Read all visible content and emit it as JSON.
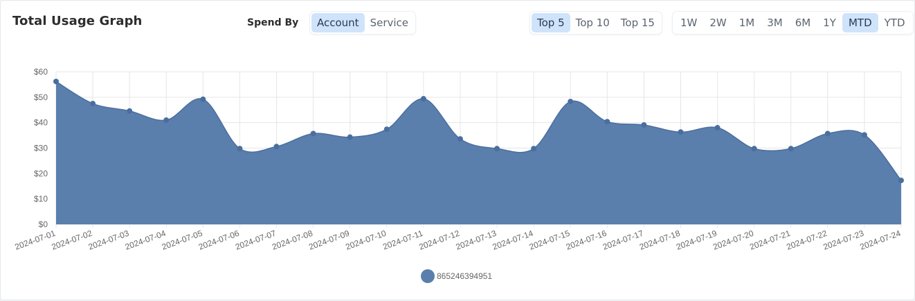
{
  "header": {
    "title": "Total Usage Graph",
    "spend_by_label": "Spend By"
  },
  "spend_by": {
    "options": [
      "Account",
      "Service"
    ],
    "selected": "Account"
  },
  "top_n": {
    "options": [
      "Top 5",
      "Top 10",
      "Top 15"
    ],
    "selected": "Top 5"
  },
  "time_range": {
    "options": [
      "1W",
      "2W",
      "1M",
      "3M",
      "6M",
      "1Y",
      "MTD",
      "YTD"
    ],
    "selected": "MTD"
  },
  "colors": {
    "series": "#5a7fac",
    "series_line": "#4a6f9e",
    "active_button": "#cfe3fb",
    "grid": "#e6e6e6"
  },
  "chart_data": {
    "type": "area",
    "title": "",
    "xlabel": "",
    "ylabel": "",
    "x": [
      "2024-07-01",
      "2024-07-02",
      "2024-07-03",
      "2024-07-04",
      "2024-07-05",
      "2024-07-06",
      "2024-07-07",
      "2024-07-08",
      "2024-07-09",
      "2024-07-10",
      "2024-07-11",
      "2024-07-12",
      "2024-07-13",
      "2024-07-14",
      "2024-07-15",
      "2024-07-16",
      "2024-07-17",
      "2024-07-18",
      "2024-07-19",
      "2024-07-20",
      "2024-07-21",
      "2024-07-22",
      "2024-07-23",
      "2024-07-24"
    ],
    "series": [
      {
        "name": "865246394951",
        "values": [
          56.2,
          47.5,
          44.6,
          41.0,
          49.2,
          29.8,
          30.6,
          35.7,
          34.3,
          37.4,
          49.4,
          33.6,
          29.8,
          29.8,
          48.3,
          40.4,
          39.1,
          36.3,
          38.0,
          29.8,
          29.8,
          35.7,
          35.2,
          17.3
        ]
      }
    ],
    "ylim": [
      0,
      60
    ],
    "yticks": [
      "$0",
      "$10",
      "$20",
      "$30",
      "$40",
      "$50",
      "$60"
    ],
    "ytick_values": [
      0,
      10,
      20,
      30,
      40,
      50,
      60
    ],
    "grid": true,
    "legend_position": "bottom-center"
  }
}
